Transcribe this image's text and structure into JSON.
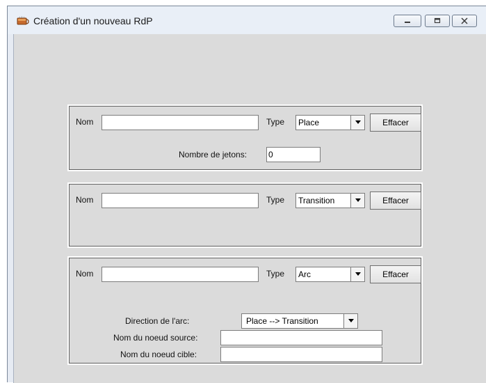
{
  "window": {
    "title": "Création d'un nouveau RdP",
    "app_icon": "coffee-cup-icon",
    "minimize_icon": "minimize-icon",
    "maximize_icon": "maximize-icon",
    "close_icon": "close-icon"
  },
  "place_panel": {
    "name_label": "Nom",
    "name_value": "",
    "type_label": "Type",
    "type_value": "Place",
    "clear_button": "Effacer",
    "tokens_label": "Nombre de jetons:",
    "tokens_value": "0"
  },
  "transition_panel": {
    "name_label": "Nom",
    "name_value": "",
    "type_label": "Type",
    "type_value": "Transition",
    "clear_button": "Effacer"
  },
  "arc_panel": {
    "name_label": "Nom",
    "name_value": "",
    "type_label": "Type",
    "type_value": "Arc",
    "clear_button": "Effacer",
    "direction_label": "Direction de l'arc:",
    "direction_value": "Place --> Transition",
    "source_label": "Nom du noeud source:",
    "source_value": "",
    "target_label": "Nom du noeud cible:",
    "target_value": ""
  },
  "colors": {
    "client_background": "#dbdbdb",
    "titlebar_background": "#e9eff7",
    "panel_border_light": "#ffffff",
    "panel_border_dark": "#5f5f5f"
  }
}
